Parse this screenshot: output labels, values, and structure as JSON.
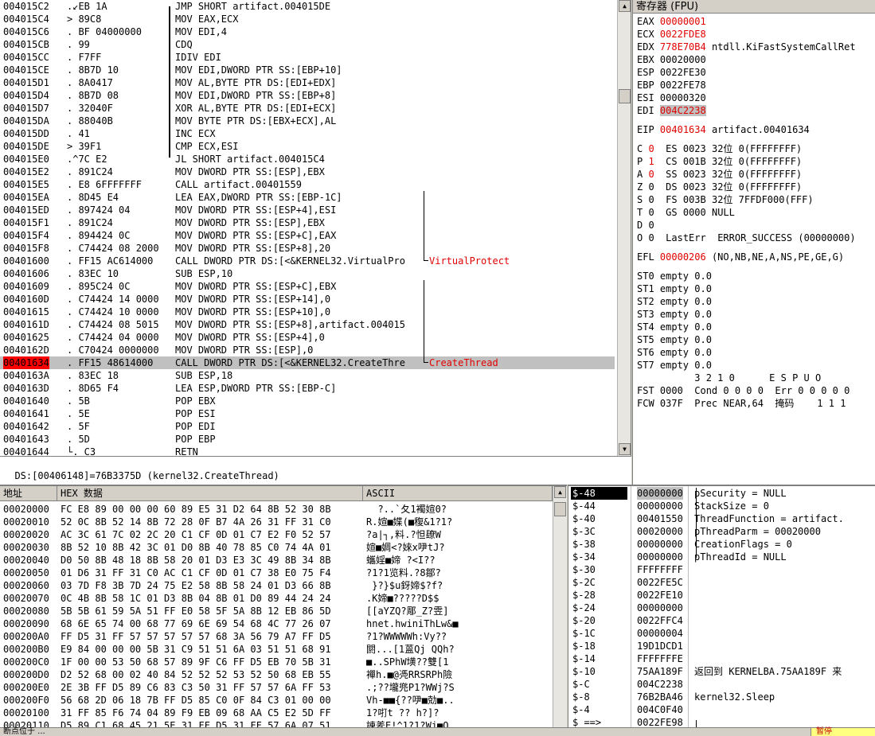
{
  "disasm": {
    "rows": [
      {
        "addr": "004015C2",
        "hex": ".↙EB 1A",
        "asm": "JMP SHORT artifact.004015DE",
        "cmt": ""
      },
      {
        "addr": "004015C4",
        "hex": "> 89C8",
        "asm": "MOV EAX,ECX",
        "cmt": ""
      },
      {
        "addr": "004015C6",
        "hex": ". BF 04000000",
        "asm": "MOV EDI,4",
        "cmt": ""
      },
      {
        "addr": "004015CB",
        "hex": ". 99",
        "asm": "CDQ",
        "cmt": ""
      },
      {
        "addr": "004015CC",
        "hex": ". F7FF",
        "asm": "IDIV EDI",
        "cmt": ""
      },
      {
        "addr": "004015CE",
        "hex": ". 8B7D 10",
        "asm": "MOV EDI,DWORD PTR SS:[EBP+10]",
        "cmt": ""
      },
      {
        "addr": "004015D1",
        "hex": ". 8A0417",
        "asm": "MOV AL,BYTE PTR DS:[EDI+EDX]",
        "cmt": ""
      },
      {
        "addr": "004015D4",
        "hex": ". 8B7D 08",
        "asm": "MOV EDI,DWORD PTR SS:[EBP+8]",
        "cmt": ""
      },
      {
        "addr": "004015D7",
        "hex": ". 32040F",
        "asm": "XOR AL,BYTE PTR DS:[EDI+ECX]",
        "cmt": ""
      },
      {
        "addr": "004015DA",
        "hex": ". 88040B",
        "asm": "MOV BYTE PTR DS:[EBX+ECX],AL",
        "cmt": ""
      },
      {
        "addr": "004015DD",
        "hex": ". 41",
        "asm": "INC ECX",
        "cmt": ""
      },
      {
        "addr": "004015DE",
        "hex": "> 39F1",
        "asm": "CMP ECX,ESI",
        "cmt": ""
      },
      {
        "addr": "004015E0",
        "hex": ".^7C E2",
        "asm": "JL SHORT artifact.004015C4",
        "cmt": ""
      },
      {
        "addr": "004015E2",
        "hex": ". 891C24",
        "asm": "MOV DWORD PTR SS:[ESP],EBX",
        "cmt": ""
      },
      {
        "addr": "004015E5",
        "hex": ". E8 6FFFFFFF",
        "asm": "CALL artifact.00401559",
        "cmt": ""
      },
      {
        "addr": "004015EA",
        "hex": ". 8D45 E4",
        "asm": "LEA EAX,DWORD PTR SS:[EBP-1C]",
        "cmt": ""
      },
      {
        "addr": "004015ED",
        "hex": ". 897424 04",
        "asm": "MOV DWORD PTR SS:[ESP+4],ESI",
        "cmt": ""
      },
      {
        "addr": "004015F1",
        "hex": ". 891C24",
        "asm": "MOV DWORD PTR SS:[ESP],EBX",
        "cmt": ""
      },
      {
        "addr": "004015F4",
        "hex": ". 894424 0C",
        "asm": "MOV DWORD PTR SS:[ESP+C],EAX",
        "cmt": ""
      },
      {
        "addr": "004015F8",
        "hex": ". C74424 08 2000",
        "asm": "MOV DWORD PTR SS:[ESP+8],20",
        "cmt": ""
      },
      {
        "addr": "00401600",
        "hex": ". FF15 AC614000",
        "asm": "CALL DWORD PTR DS:[<&KERNEL32.VirtualPro",
        "cmt": "VirtualProtect"
      },
      {
        "addr": "00401606",
        "hex": ". 83EC 10",
        "asm": "SUB ESP,10",
        "cmt": ""
      },
      {
        "addr": "00401609",
        "hex": ". 895C24 0C",
        "asm": "MOV DWORD PTR SS:[ESP+C],EBX",
        "cmt": ""
      },
      {
        "addr": "0040160D",
        "hex": ". C74424 14 0000",
        "asm": "MOV DWORD PTR SS:[ESP+14],0",
        "cmt": ""
      },
      {
        "addr": "00401615",
        "hex": ". C74424 10 0000",
        "asm": "MOV DWORD PTR SS:[ESP+10],0",
        "cmt": ""
      },
      {
        "addr": "0040161D",
        "hex": ". C74424 08 5015",
        "asm": "MOV DWORD PTR SS:[ESP+8],artifact.004015",
        "cmt": ""
      },
      {
        "addr": "00401625",
        "hex": ". C74424 04 0000",
        "asm": "MOV DWORD PTR SS:[ESP+4],0",
        "cmt": ""
      },
      {
        "addr": "0040162D",
        "hex": ". C70424 0000000",
        "asm": "MOV DWORD PTR SS:[ESP],0",
        "cmt": ""
      },
      {
        "addr": "00401634",
        "hex": ". FF15 48614000",
        "asm": "CALL DWORD PTR DS:[<&KERNEL32.CreateThre",
        "cmt": "CreateThread",
        "selected": true
      },
      {
        "addr": "0040163A",
        "hex": ". 83EC 18",
        "asm": "SUB ESP,18",
        "cmt": ""
      },
      {
        "addr": "0040163D",
        "hex": ". 8D65 F4",
        "asm": "LEA ESP,DWORD PTR SS:[EBP-C]",
        "cmt": ""
      },
      {
        "addr": "00401640",
        "hex": ". 5B",
        "asm": "POP EBX",
        "cmt": ""
      },
      {
        "addr": "00401641",
        "hex": ". 5E",
        "asm": "POP ESI",
        "cmt": ""
      },
      {
        "addr": "00401642",
        "hex": ". 5F",
        "asm": "POP EDI",
        "cmt": ""
      },
      {
        "addr": "00401643",
        "hex": ". 5D",
        "asm": "POP EBP",
        "cmt": ""
      },
      {
        "addr": "00401644",
        "hex": "└. C3",
        "asm": "RETN",
        "cmt": ""
      }
    ]
  },
  "info_line": "DS:[00406148]=76B3375D (kernel32.CreateThread)",
  "registers": {
    "title": "寄存器 (FPU)",
    "gpr": [
      {
        "name": "EAX",
        "value": "00000001",
        "changed": true,
        "note": ""
      },
      {
        "name": "ECX",
        "value": "0022FDE8",
        "changed": true,
        "note": ""
      },
      {
        "name": "EDX",
        "value": "778E70B4",
        "changed": true,
        "note": "ntdll.KiFastSystemCallRet"
      },
      {
        "name": "EBX",
        "value": "00020000",
        "changed": false,
        "note": ""
      },
      {
        "name": "ESP",
        "value": "0022FE30",
        "changed": false,
        "note": ""
      },
      {
        "name": "EBP",
        "value": "0022FE78",
        "changed": false,
        "note": ""
      },
      {
        "name": "ESI",
        "value": "00000320",
        "changed": false,
        "note": ""
      },
      {
        "name": "EDI",
        "value": "004C2238",
        "changed": true,
        "note": "",
        "highlight": true
      }
    ],
    "eip": {
      "name": "EIP",
      "value": "00401634",
      "note": "artifact.00401634"
    },
    "segs": [
      {
        "flag": "C",
        "fval": "0",
        "fchanged": true,
        "seg": "ES",
        "sel": "0023",
        "bits": "32位",
        "base": "0(FFFFFFFF)"
      },
      {
        "flag": "P",
        "fval": "1",
        "fchanged": true,
        "seg": "CS",
        "sel": "001B",
        "bits": "32位",
        "base": "0(FFFFFFFF)"
      },
      {
        "flag": "A",
        "fval": "0",
        "fchanged": true,
        "seg": "SS",
        "sel": "0023",
        "bits": "32位",
        "base": "0(FFFFFFFF)"
      },
      {
        "flag": "Z",
        "fval": "0",
        "fchanged": false,
        "seg": "DS",
        "sel": "0023",
        "bits": "32位",
        "base": "0(FFFFFFFF)"
      },
      {
        "flag": "S",
        "fval": "0",
        "fchanged": false,
        "seg": "FS",
        "sel": "003B",
        "bits": "32位",
        "base": "7FFDF000(FFF)"
      },
      {
        "flag": "T",
        "fval": "0",
        "fchanged": false,
        "seg": "GS",
        "sel": "0000",
        "bits": "",
        "base": "NULL"
      },
      {
        "flag": "D",
        "fval": "0",
        "fchanged": false,
        "seg": "",
        "sel": "",
        "bits": "",
        "base": ""
      },
      {
        "flag": "O",
        "fval": "0",
        "fchanged": false,
        "seg": "LastErr",
        "sel": "",
        "bits": "",
        "base": "ERROR_SUCCESS (00000000)"
      }
    ],
    "efl": {
      "name": "EFL",
      "value": "00000206",
      "note": "(NO,NB,NE,A,NS,PE,GE,G)"
    },
    "st": [
      "ST0 empty 0.0",
      "ST1 empty 0.0",
      "ST2 empty 0.0",
      "ST3 empty 0.0",
      "ST4 empty 0.0",
      "ST5 empty 0.0",
      "ST6 empty 0.0",
      "ST7 empty 0.0"
    ],
    "fpu_header": "          3 2 1 0      E S P U O",
    "fst": "FST 0000  Cond 0 0 0 0  Err 0 0 0 0 0",
    "fcw": "FCW 037F  Prec NEAR,64  掩码    1 1 1"
  },
  "dump": {
    "headers": {
      "addr": "地址",
      "hex": "HEX 数据",
      "ascii": "ASCII"
    },
    "rows": [
      {
        "addr": "00020000",
        "hex": "FC E8 89 00 00 00 60 89 E5 31 D2 64 8B 52 30 8B",
        "ascii": "  ?..`夂1襡媗0?"
      },
      {
        "addr": "00020010",
        "hex": "52 0C 8B 52 14 8B 72 28 0F B7 4A 26 31 FF 31 C0",
        "ascii": "R.媗■媟(■稪&1?1?"
      },
      {
        "addr": "00020020",
        "hex": "AC 3C 61 7C 02 2C 20 C1 CF 0D 01 C7 E2 F0 52 57",
        "ascii": "?a|┐,料.?怛镽W"
      },
      {
        "addr": "00020030",
        "hex": "8B 52 10 8B 42 3C 01 D0 8B 40 78 85 C0 74 4A 01",
        "ascii": "媗■婤<?婡x吚tJ?"
      },
      {
        "addr": "00020040",
        "hex": "D0 50 8B 48 18 8B 58 20 01 D3 E3 3C 49 8B 34 8B",
        "ascii": "蠵婬■媂 ?<I??"
      },
      {
        "addr": "00020050",
        "hex": "01 D6 31 FF 31 C0 AC C1 CF 0D 01 C7 38 E0 75 F4",
        "ascii": "?1?1览料.?8鄒?"
      },
      {
        "addr": "00020060",
        "hex": "03 7D F8 3B 7D 24 75 E2 58 8B 58 24 01 D3 66 8B",
        "ascii": " }?}$u釾媂$?f?"
      },
      {
        "addr": "00020070",
        "hex": "0C 4B 8B 58 1C 01 D3 8B 04 8B 01 D0 89 44 24 24",
        "ascii": ".K媂■?????D$$"
      },
      {
        "addr": "00020080",
        "hex": "5B 5B 61 59 5A 51 FF E0 58 5F 5A 8B 12 EB 86 5D",
        "ascii": "[[aYZQ?郮_Z?雴]"
      },
      {
        "addr": "00020090",
        "hex": "68 6E 65 74 00 68 77 69 6E 69 54 68 4C 77 26 07",
        "ascii": "hnet.hwiniThLw&■"
      },
      {
        "addr": "000200A0",
        "hex": "FF D5 31 FF 57 57 57 57 57 68 3A 56 79 A7 FF D5",
        "ascii": "?1?WWWWWh:Vy??"
      },
      {
        "addr": "000200B0",
        "hex": "E9 84 00 00 00 5B 31 C9 51 51 6A 03 51 51 68 91",
        "ascii": "閼...[1蒕Qj QQh?"
      },
      {
        "addr": "000200C0",
        "hex": "1F 00 00 53 50 68 57 89 9F C6 FF D5 EB 70 5B 31",
        "ascii": "■..SPhW墴??雙[1"
      },
      {
        "addr": "000200D0",
        "hex": "D2 52 68 00 02 40 84 52 52 52 53 52 50 68 EB 55",
        "ascii": "襌h.■@凴RRSRPh險"
      },
      {
        "addr": "000200E0",
        "hex": "2E 3B FF D5 89 C6 83 C3 50 31 FF 57 57 6A FF 53",
        "ascii": ".;??壠兠P1?WWj?S"
      },
      {
        "addr": "000200F0",
        "hex": "56 68 2D 06 18 7B FF D5 85 C0 0F 84 C3 01 00 00",
        "ascii": "Vh-■■{??吚■勀■.."
      },
      {
        "addr": "00020100",
        "hex": "31 FF 85 F6 74 04 89 F9 EB 09 68 AA C5 E2 5D FF",
        "ascii": "1?咑t ?? h?]?"
      },
      {
        "addr": "00020110",
        "hex": "D5 89 C1 68 45 21 5E 31 FF D5 31 FF 57 6A 07 51",
        "ascii": "諌羑E!^1?1?Wj■Q"
      }
    ]
  },
  "stack": {
    "rows": [
      {
        "off": "$-48",
        "val": "00000000",
        "cmt": "pSecurity = NULL",
        "selected": true
      },
      {
        "off": "$-44",
        "val": "00000000",
        "cmt": "StackSize = 0"
      },
      {
        "off": "$-40",
        "val": "00401550",
        "cmt": "ThreadFunction = artifact."
      },
      {
        "off": "$-3C",
        "val": "00020000",
        "cmt": "pThreadParm = 00020000"
      },
      {
        "off": "$-38",
        "val": "00000000",
        "cmt": "CreationFlags = 0"
      },
      {
        "off": "$-34",
        "val": "00000000",
        "cmt": "pThreadId = NULL"
      },
      {
        "off": "$-30",
        "val": "FFFFFFFF",
        "cmt": ""
      },
      {
        "off": "$-2C",
        "val": "0022FE5C",
        "cmt": ""
      },
      {
        "off": "$-28",
        "val": "0022FE10",
        "cmt": ""
      },
      {
        "off": "$-24",
        "val": "00000000",
        "cmt": ""
      },
      {
        "off": "$-20",
        "val": "0022FFC4",
        "cmt": ""
      },
      {
        "off": "$-1C",
        "val": "00000004",
        "cmt": ""
      },
      {
        "off": "$-18",
        "val": "19D1DCD1",
        "cmt": ""
      },
      {
        "off": "$-14",
        "val": "FFFFFFFE",
        "cmt": ""
      },
      {
        "off": "$-10",
        "val": "75AA189F",
        "cmt": "返回到 KERNELBA.75AA189F 来"
      },
      {
        "off": "$-C",
        "val": "004C2238",
        "cmt": ""
      },
      {
        "off": "$-8",
        "val": "76B2BA46",
        "cmt": "kernel32.Sleep"
      },
      {
        "off": "$-4",
        "val": "004C0F40",
        "cmt": ""
      },
      {
        "off": "$ ==>",
        "val": "0022FE98",
        "cmt": ""
      }
    ]
  },
  "status": {
    "left": "断点位于 ...",
    "right": "暂停"
  }
}
